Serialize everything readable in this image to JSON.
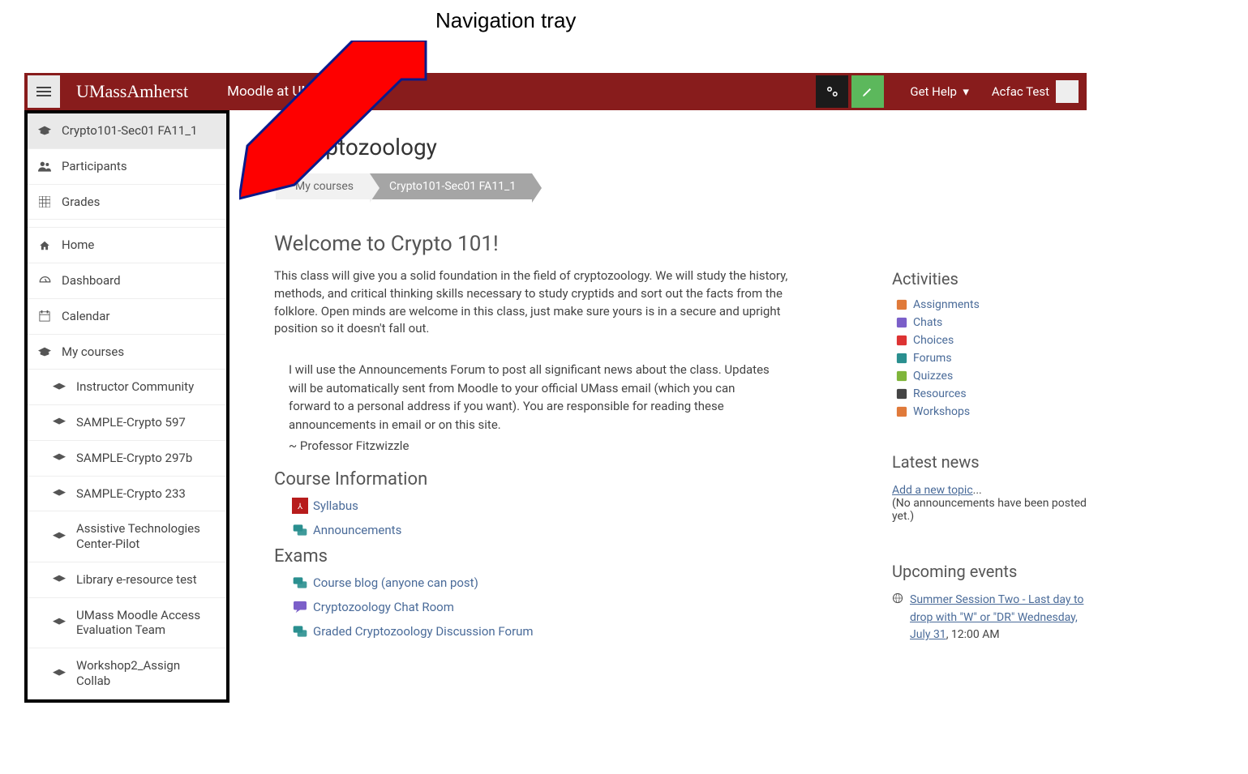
{
  "annotation": {
    "label": "Navigation tray"
  },
  "topbar": {
    "brand": "UMassAmherst",
    "tagline": "Moodle at UMass",
    "gethelp_label": "Get Help",
    "username": "Acfac Test"
  },
  "nav": {
    "items": [
      {
        "label": "Crypto101-Sec01 FA11_1",
        "icon": "graduation"
      },
      {
        "label": "Participants",
        "icon": "users"
      },
      {
        "label": "Grades",
        "icon": "grid"
      },
      {
        "label": "Home",
        "icon": "home"
      },
      {
        "label": "Dashboard",
        "icon": "gauge"
      },
      {
        "label": "Calendar",
        "icon": "calendar"
      },
      {
        "label": "My courses",
        "icon": "graduation"
      },
      {
        "label": "Instructor Community",
        "icon": "graduation"
      },
      {
        "label": "SAMPLE-Crypto 597",
        "icon": "graduation"
      },
      {
        "label": "SAMPLE-Crypto 297b",
        "icon": "graduation"
      },
      {
        "label": "SAMPLE-Crypto 233",
        "icon": "graduation"
      },
      {
        "label": "Assistive Technologies Center-Pilot",
        "icon": "graduation"
      },
      {
        "label": "Library e-resource test",
        "icon": "graduation"
      },
      {
        "label": "UMass Moodle Access Evaluation Team",
        "icon": "graduation"
      },
      {
        "label": "Workshop2_Assign Collab",
        "icon": "graduation"
      }
    ]
  },
  "page": {
    "title_suffix": "Cryptozoology",
    "breadcrumb": {
      "mid": "My courses",
      "last": "Crypto101-Sec01 FA11_1"
    },
    "welcome": "Welcome to Crypto 101!",
    "intro": "This class will give you a solid foundation in the field of cryptozoology. We will study the history, methods, and critical thinking skills necessary to study cryptids and sort out the facts from the folklore. Open minds are welcome in this class, just make sure yours is in a secure and upright position so it doesn't fall out.",
    "note": "I will use the Announcements Forum to post all significant news about the class. Updates will be automatically sent from Moodle to your official UMass email (which you can forward to a personal address if you want). You are responsible for reading these announcements in email or on this site.",
    "sig": "~ Professor Fitzwizzle",
    "sections": {
      "course_info": {
        "title": "Course Information",
        "items": [
          {
            "label": "Syllabus",
            "icon": "pdf",
            "color": "#b71c1c"
          },
          {
            "label": "Announcements",
            "icon": "forum",
            "color": "#2a8f8f"
          }
        ]
      },
      "exams": {
        "title": "Exams",
        "items": [
          {
            "label": "Course blog (anyone can post)",
            "icon": "forum",
            "color": "#2a8f8f"
          },
          {
            "label": "Cryptozoology Chat Room",
            "icon": "chat",
            "color": "#7b5fc9"
          },
          {
            "label": "Graded Cryptozoology Discussion Forum",
            "icon": "forum",
            "color": "#2a8f8f"
          }
        ]
      }
    }
  },
  "activities": {
    "title": "Activities",
    "items": [
      {
        "label": "Assignments",
        "color": "#e07a3a"
      },
      {
        "label": "Chats",
        "color": "#7b5fc9"
      },
      {
        "label": "Choices",
        "color": "#d33"
      },
      {
        "label": "Forums",
        "color": "#2a8f8f"
      },
      {
        "label": "Quizzes",
        "color": "#7fb53a"
      },
      {
        "label": "Resources",
        "color": "#444"
      },
      {
        "label": "Workshops",
        "color": "#e07a3a"
      }
    ]
  },
  "latest_news": {
    "title": "Latest news",
    "link": "Add a new topic",
    "ellipsis": "...",
    "empty": "(No announcements have been posted yet.)"
  },
  "upcoming": {
    "title": "Upcoming events",
    "event_text": "Summer Session Two - Last day to drop with \"W\" or \"DR\" Wednesday, July 31",
    "event_time": ", 12:00 AM"
  },
  "colors": {
    "brand": "#881c1c",
    "link": "#4a6b99"
  }
}
